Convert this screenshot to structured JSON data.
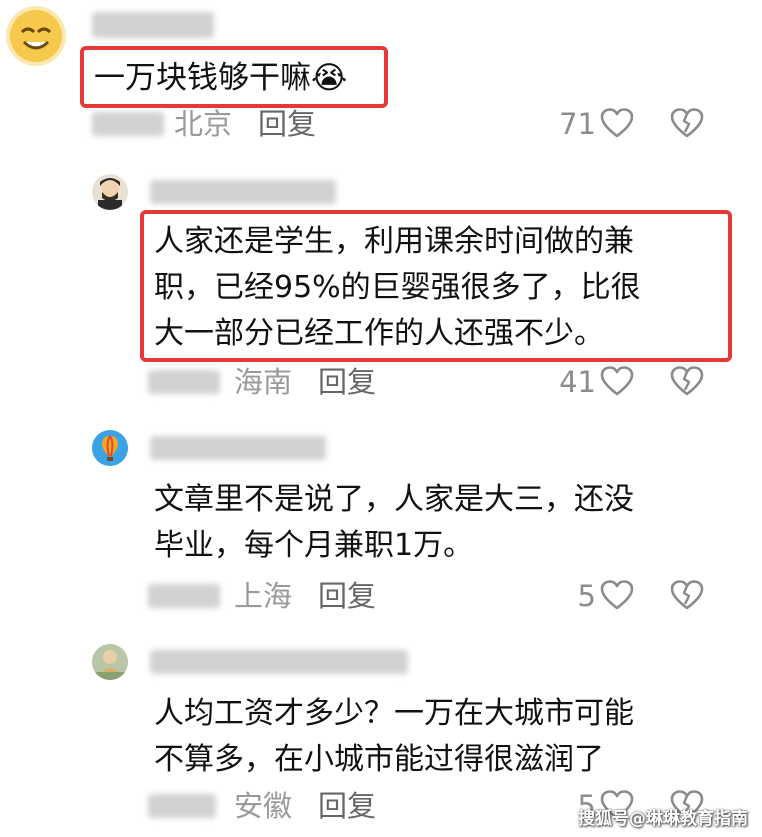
{
  "comments": [
    {
      "text_lines": [
        "一万块钱够干嘛"
      ],
      "emoji": "😭",
      "location": "北京",
      "reply_label": "回复",
      "likes": "71"
    },
    {
      "text_lines": [
        "人家还是学生，利用课余时间做的兼",
        "职，已经95%的巨婴强很多了，比很",
        "大一部分已经工作的人还强不少。"
      ],
      "location": "海南",
      "reply_label": "回复",
      "likes": "41"
    },
    {
      "text_lines": [
        "文章里不是说了，人家是大三，还没",
        "毕业，每个月兼职1万。"
      ],
      "location": "上海",
      "reply_label": "回复",
      "likes": "5"
    },
    {
      "text_lines": [
        "人均工资才多少？一万在大城市可能",
        "不算多，在小城市能过得很滋润了"
      ],
      "location": "安徽",
      "reply_label": "回复",
      "likes": "5"
    }
  ],
  "watermark": "搜狐号@琳琳教育指南",
  "colors": {
    "highlight_border": "#e53935",
    "meta_text": "#9a9a9a",
    "icon_stroke": "#8a8a8a"
  },
  "icons": [
    "like-heart-icon",
    "dislike-broken-heart-icon"
  ]
}
